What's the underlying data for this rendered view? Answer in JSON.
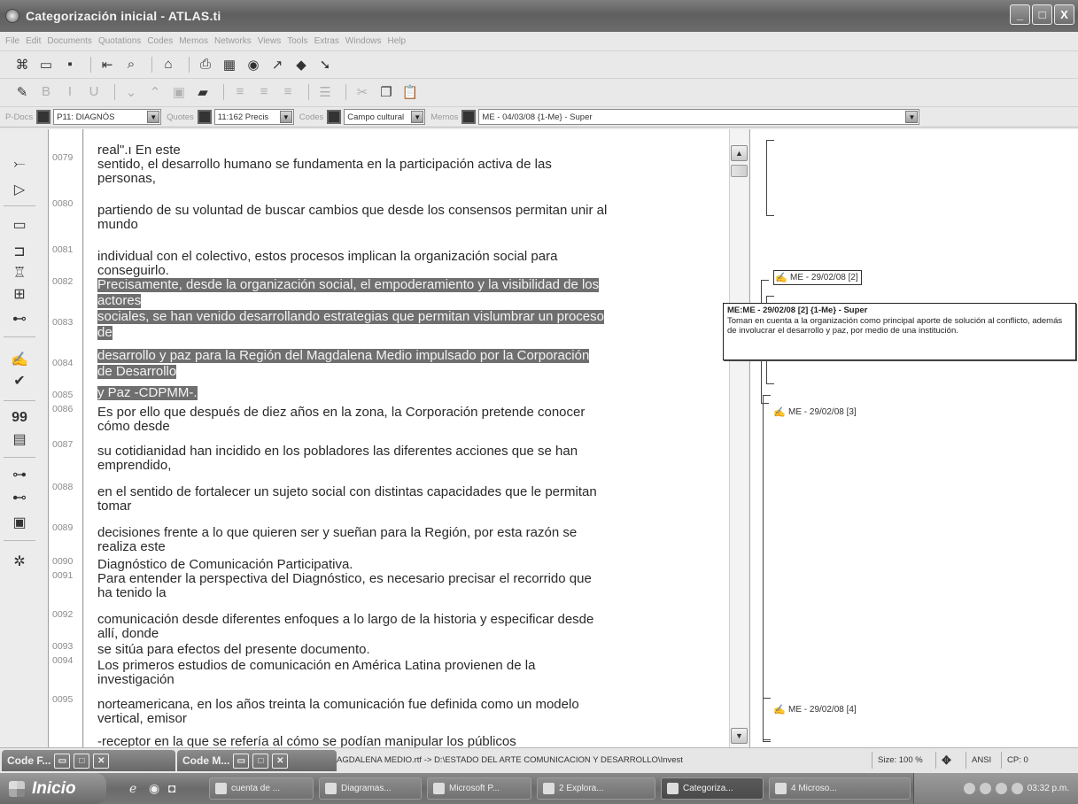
{
  "window": {
    "title": "Categorización inicial - ATLAS.ti",
    "buttons": {
      "minimize": "_",
      "maximize": "□",
      "close": "X"
    }
  },
  "menu": [
    "File",
    "Edit",
    "Documents",
    "Quotations",
    "Codes",
    "Memos",
    "Networks",
    "Views",
    "Tools",
    "Extras",
    "Windows",
    "Help"
  ],
  "selectors": {
    "pdocs_label": "P-Docs",
    "pdocs_value": "P11: DIAGNÓS",
    "quotes_label": "Quotes",
    "quotes_value": "11:162 Precis",
    "codes_label": "Codes",
    "codes_value": "Campo cultural",
    "memos_label": "Memos",
    "memos_value": "ME - 04/03/08 {1-Me} - Super"
  },
  "document": {
    "lines": [
      {
        "num": "",
        "text": "real\".ı En este",
        "hl": false
      },
      {
        "num": "0079",
        "text": "sentido, el desarrollo humano se fundamenta en la participación activa de las",
        "hl": false
      },
      {
        "num": "",
        "text": "personas,",
        "hl": false
      },
      {
        "num": "0080",
        "text": "partiendo de su voluntad de buscar cambios que desde los consensos permitan unir al",
        "hl": false
      },
      {
        "num": "",
        "text": "mundo",
        "hl": false
      },
      {
        "num": "0081",
        "text": "individual con el colectivo, estos procesos implican la organización social para",
        "hl": false
      },
      {
        "num": "",
        "text": "conseguirlo.",
        "hl": false
      },
      {
        "num": "0082",
        "text": "Precisamente, desde la organización social, el empoderamiento y la visibilidad de los",
        "hl": true
      },
      {
        "num": "",
        "text": "actores",
        "hl": true
      },
      {
        "num": "0083",
        "text": "sociales, se han venido desarrollando estrategias que permitan vislumbrar un proceso",
        "hl": true
      },
      {
        "num": "",
        "text": "de",
        "hl": true
      },
      {
        "num": "0084",
        "text": "desarrollo y paz para la Región del Magdalena Medio impulsado por la Corporación",
        "hl": true
      },
      {
        "num": "",
        "text": "de Desarrollo",
        "hl": true
      },
      {
        "num": "0085",
        "text": "y Paz -CDPMM-.",
        "hl": true
      },
      {
        "num": "0086",
        "text": "Es por ello que después de diez años en la zona, la Corporación pretende conocer",
        "hl": false
      },
      {
        "num": "",
        "text": "cómo desde",
        "hl": false
      },
      {
        "num": "0087",
        "text": "su cotidianidad han incidido en los pobladores las diferentes acciones que se han",
        "hl": false
      },
      {
        "num": "",
        "text": "emprendido,",
        "hl": false
      },
      {
        "num": "0088",
        "text": "en el sentido de fortalecer un sujeto social con distintas capacidades que le permitan",
        "hl": false
      },
      {
        "num": "",
        "text": "tomar",
        "hl": false
      },
      {
        "num": "0089",
        "text": "decisiones frente a lo que quieren ser y sueñan para la Región, por esta razón se",
        "hl": false
      },
      {
        "num": "",
        "text": "realiza este",
        "hl": false
      },
      {
        "num": "0090",
        "text": "Diagnóstico de Comunicación Participativa.",
        "hl": false
      },
      {
        "num": "0091",
        "text": "Para entender la perspectiva del Diagnóstico, es necesario precisar el recorrido que",
        "hl": false
      },
      {
        "num": "",
        "text": "ha tenido la",
        "hl": false
      },
      {
        "num": "0092",
        "text": "comunicación desde diferentes enfoques a lo largo de la historia y especificar desde",
        "hl": false
      },
      {
        "num": "",
        "text": "allí, donde",
        "hl": false
      },
      {
        "num": "0093",
        "text": "se sitúa para efectos del presente documento.",
        "hl": false
      },
      {
        "num": "0094",
        "text": "Los primeros estudios de comunicación en América Latina provienen de la",
        "hl": false
      },
      {
        "num": "",
        "text": "investigación",
        "hl": false
      },
      {
        "num": "0095",
        "text": "norteamericana, en los años treinta la comunicación fue definida como un modelo",
        "hl": false
      },
      {
        "num": "",
        "text": "vertical, emisor",
        "hl": false
      },
      {
        "num": "",
        "text": "-receptor en la que se refería al cómo se podían manipular los públicos",
        "hl": false
      }
    ]
  },
  "margin": {
    "memo1": "ME - 29/02/08 [2]",
    "memo2": "ME - 29/02/08 [3]",
    "memo3": "ME - 29/02/08 [4]"
  },
  "tooltip": {
    "title": "ME:ME - 29/02/08 [2] {1-Me} - Super",
    "body": "Toman en cuenta  a la organización como principal aporte de solución al conflicto, además de involucrar el desarrollo y paz, por medio de una institución."
  },
  "status": {
    "mini1": "Code F...",
    "mini2": "Code M...",
    "path": "AGDALENA MEDIO.rtf -> D:\\ESTADO DEL ARTE COMUNICACION Y DESARROLLO\\Invest",
    "size": "Size: 100 %",
    "encoding": "ANSI",
    "cp": "CP: 0"
  },
  "taskbar": {
    "start": "Inicio",
    "tasks": [
      "cuenta de ...",
      "Diagramas...",
      "Microsoft P...",
      "2 Explora...",
      "Categoriza...",
      "4 Microso..."
    ],
    "clock": "03:32 p.m."
  }
}
